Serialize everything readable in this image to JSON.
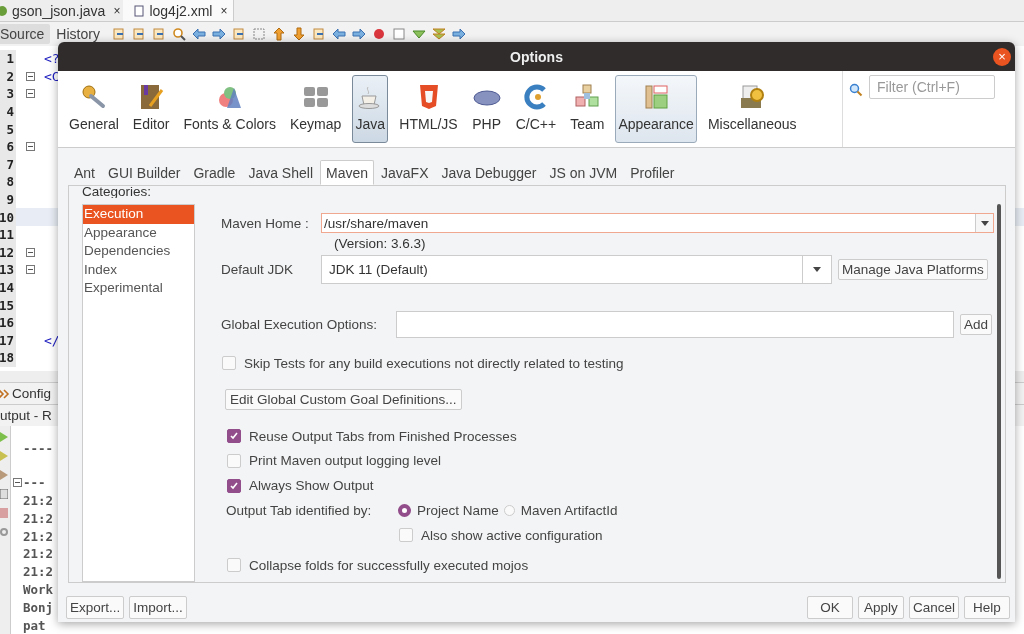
{
  "editor_tabs": [
    {
      "label": "gson_json.java",
      "close": "×",
      "selected": false
    },
    {
      "label": "log4j2.xml",
      "close": "×",
      "selected": true
    }
  ],
  "editor_views": [
    {
      "label": "Source",
      "selected": true
    },
    {
      "label": "History",
      "selected": false
    }
  ],
  "editor_lines": [
    {
      "number": "1",
      "code": "<?",
      "fold": false,
      "current": false
    },
    {
      "number": "2",
      "code": "<C",
      "fold": true,
      "current": false
    },
    {
      "number": "3",
      "fold": true,
      "current": false
    },
    {
      "number": "4",
      "fold": false,
      "current": false
    },
    {
      "number": "5",
      "fold": false,
      "current": false
    },
    {
      "number": "6",
      "fold": true,
      "current": false
    },
    {
      "number": "7",
      "fold": false,
      "current": false
    },
    {
      "number": "8",
      "fold": false,
      "current": false
    },
    {
      "number": "9",
      "fold": false,
      "current": false
    },
    {
      "number": "10",
      "fold": false,
      "current": true
    },
    {
      "number": "11",
      "fold": false,
      "current": false
    },
    {
      "number": "12",
      "fold": true,
      "current": false
    },
    {
      "number": "13",
      "fold": true,
      "current": false
    },
    {
      "number": "14",
      "fold": false,
      "current": false
    },
    {
      "number": "15",
      "fold": false,
      "current": false
    },
    {
      "number": "16",
      "fold": false,
      "current": false
    },
    {
      "number": "17",
      "code": "</",
      "fold": false,
      "current": false
    },
    {
      "number": "18",
      "fold": false,
      "current": false
    }
  ],
  "bottom_tab": "Config",
  "output_title": "utput - R",
  "output_lines": [
    {
      "text": "----",
      "fold": false
    },
    {
      "text": "---",
      "fold": true
    },
    {
      "text": "21:2",
      "fold": false
    },
    {
      "text": "21:2",
      "fold": false
    },
    {
      "text": "21:2",
      "fold": false
    },
    {
      "text": "21:2",
      "fold": false
    },
    {
      "text": "21:2",
      "fold": false
    },
    {
      "text": "Work",
      "fold": false
    },
    {
      "text": "Bonj",
      "fold": false
    },
    {
      "text": "pat",
      "fold": false
    }
  ],
  "dialog": {
    "title": "Options",
    "close": "×",
    "categories": [
      {
        "label": "General",
        "kind": "general",
        "selected": false,
        "hovered": false
      },
      {
        "label": "Editor",
        "kind": "editor",
        "selected": false,
        "hovered": false
      },
      {
        "label": "Fonts & Colors",
        "kind": "fonts",
        "selected": false,
        "hovered": false
      },
      {
        "label": "Keymap",
        "kind": "keymap",
        "selected": false,
        "hovered": false
      },
      {
        "label": "Java",
        "kind": "java",
        "selected": true,
        "hovered": false
      },
      {
        "label": "HTML/JS",
        "kind": "html",
        "selected": false,
        "hovered": false
      },
      {
        "label": "PHP",
        "kind": "php",
        "selected": false,
        "hovered": false
      },
      {
        "label": "C/C++",
        "kind": "cpp",
        "selected": false,
        "hovered": false
      },
      {
        "label": "Team",
        "kind": "team",
        "selected": false,
        "hovered": false
      },
      {
        "label": "Appearance",
        "kind": "appearance",
        "selected": false,
        "hovered": true
      },
      {
        "label": "Miscellaneous",
        "kind": "misc",
        "selected": false,
        "hovered": false
      }
    ],
    "filter": {
      "placeholder": "Filter (Ctrl+F)"
    },
    "tabs": [
      {
        "label": "Ant",
        "selected": false
      },
      {
        "label": "GUI Builder",
        "selected": false
      },
      {
        "label": "Gradle",
        "selected": false
      },
      {
        "label": "Java Shell",
        "selected": false
      },
      {
        "label": "Maven",
        "selected": true
      },
      {
        "label": "JavaFX",
        "selected": false
      },
      {
        "label": "Java Debugger",
        "selected": false
      },
      {
        "label": "JS on JVM",
        "selected": false
      },
      {
        "label": "Profiler",
        "selected": false
      }
    ],
    "categories_label": "Categories:",
    "maven_categories": [
      {
        "label": "Execution",
        "selected": true
      },
      {
        "label": "Appearance",
        "selected": false
      },
      {
        "label": "Dependencies",
        "selected": false
      },
      {
        "label": "Index",
        "selected": false
      },
      {
        "label": "Experimental",
        "selected": false
      }
    ],
    "maven_home": {
      "label": "Maven Home :",
      "value": "/usr/share/maven",
      "focused": true,
      "version": "(Version: 3.6.3)"
    },
    "default_jdk": {
      "label": "Default JDK",
      "value": "JDK 11 (Default)",
      "button": "Manage Java Platforms"
    },
    "global_options": {
      "label": "Global Execution Options:",
      "button": "Add"
    },
    "skip_tests": {
      "label": "Skip Tests for any build executions not directly related to testing",
      "checked": false
    },
    "edit_goals_button": "Edit Global Custom Goal Definitions...",
    "output_options": [
      {
        "label": "Reuse Output Tabs from Finished Processes",
        "checked": true
      },
      {
        "label": "Print Maven output logging level",
        "checked": false
      },
      {
        "label": "Always Show Output",
        "checked": true
      }
    ],
    "output_tab": {
      "label": "Output Tab identified by:",
      "options": [
        {
          "label": "Project Name",
          "selected": true
        },
        {
          "label": "Maven ArtifactId",
          "selected": false
        }
      ],
      "also_show": {
        "label": "Also show active configuration",
        "checked": false
      }
    },
    "collapse_folds": {
      "label": "Collapse folds for successfully executed mojos",
      "checked": false
    },
    "left_buttons": [
      "Export...",
      "Import..."
    ],
    "right_buttons": [
      "OK",
      "Apply",
      "Cancel",
      "Help"
    ]
  }
}
